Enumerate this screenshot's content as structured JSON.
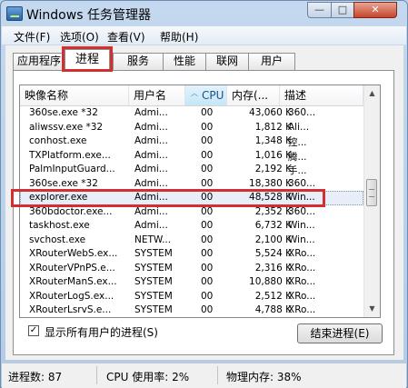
{
  "window": {
    "title": "Windows 任务管理器",
    "controls": [
      "—",
      "□",
      "✕"
    ]
  },
  "menu": [
    {
      "label": "文件(F)"
    },
    {
      "label": "选项(O)"
    },
    {
      "label": "查看(V)"
    },
    {
      "label": "帮助(H)"
    }
  ],
  "tabs": [
    {
      "label": "应用程序",
      "active": false
    },
    {
      "label": "进程",
      "active": true
    },
    {
      "label": "服务",
      "active": false
    },
    {
      "label": "性能",
      "active": false
    },
    {
      "label": "联网",
      "active": false
    },
    {
      "label": "用户",
      "active": false
    }
  ],
  "columns": {
    "name": "映像名称",
    "user": "用户名",
    "cpu": "CPU",
    "mem": "内存(...",
    "desc": "描述"
  },
  "rows": [
    {
      "name": "360se.exe *32",
      "user": "Admi...",
      "cpu": "00",
      "mem": "43,060 K",
      "desc": "360..."
    },
    {
      "name": "aliwssv.exe *32",
      "user": "Admi...",
      "cpu": "00",
      "mem": "1,812 K",
      "desc": "Ali..."
    },
    {
      "name": "conhost.exe",
      "user": "Admi...",
      "cpu": "00",
      "mem": "1,348 K",
      "desc": "控..."
    },
    {
      "name": "TXPlatform.exe...",
      "user": "Admi...",
      "cpu": "00",
      "mem": "1,016 K",
      "desc": "腾..."
    },
    {
      "name": "PalmInputGuard...",
      "user": "Admi...",
      "cpu": "00",
      "mem": "2,192 K",
      "desc": "手..."
    },
    {
      "name": "360se.exe *32",
      "user": "Admi...",
      "cpu": "00",
      "mem": "18,380 K",
      "desc": "360..."
    },
    {
      "name": "explorer.exe",
      "user": "Admi...",
      "cpu": "00",
      "mem": "48,528 K",
      "desc": "Win..."
    },
    {
      "name": "360bdoctor.exe...",
      "user": "Admi...",
      "cpu": "00",
      "mem": "2,352 K",
      "desc": "360..."
    },
    {
      "name": "taskhost.exe",
      "user": "Admi...",
      "cpu": "00",
      "mem": "6,732 K",
      "desc": "Win..."
    },
    {
      "name": "svchost.exe",
      "user": "NETW...",
      "cpu": "00",
      "mem": "2,100 K",
      "desc": "Win..."
    },
    {
      "name": "XRouterWebS.ex...",
      "user": "SYSTEM",
      "cpu": "00",
      "mem": "5,524 K",
      "desc": "XRo..."
    },
    {
      "name": "XRouterVPnPS.e...",
      "user": "SYSTEM",
      "cpu": "00",
      "mem": "2,316 K",
      "desc": "XRo..."
    },
    {
      "name": "XRouterManS.ex...",
      "user": "SYSTEM",
      "cpu": "00",
      "mem": "10,880 K",
      "desc": "XRo..."
    },
    {
      "name": "XRouterLogS.ex...",
      "user": "SYSTEM",
      "cpu": "00",
      "mem": "2,512 K",
      "desc": "XRo..."
    },
    {
      "name": "XRouterLsrvS.e...",
      "user": "SYSTEM",
      "cpu": "00",
      "mem": "4,788 K",
      "desc": "XRo..."
    }
  ],
  "selected_row": "explorer.exe",
  "show_all_users": {
    "label": "显示所有用户的进程(S)",
    "checked": true,
    "mark": "✓"
  },
  "end_process_button": "结束进程(E)",
  "status": {
    "processes": "进程数: 87",
    "cpu": "CPU 使用率: 2%",
    "memory": "物理内存: 38%"
  },
  "colors": {
    "highlight_box": "#d23030",
    "sort_column": "#c6e6f8"
  }
}
